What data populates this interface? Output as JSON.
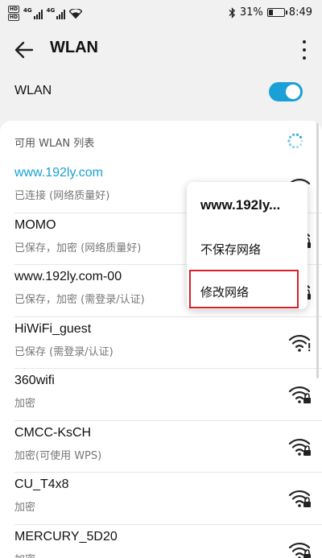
{
  "status_bar": {
    "hd_badges": [
      "HD",
      "HD"
    ],
    "network_tags": [
      "4G",
      "4G"
    ],
    "battery_percent": "31%",
    "battery_level": 0.31,
    "time": "8:49",
    "icons": [
      "bluetooth-icon",
      "wifi-icon",
      "signal-icon",
      "battery-icon"
    ]
  },
  "app_bar": {
    "title": "WLAN",
    "back_icon": "arrow-left-icon",
    "menu_icon": "more-vertical-icon"
  },
  "wlan_toggle": {
    "label": "WLAN",
    "on": true
  },
  "section": {
    "title": "可用 WLAN 列表"
  },
  "networks": [
    {
      "ssid": "www.192ly.com",
      "status": "已连接 (网络质量好)",
      "connected": true,
      "icon": "wifi-icon"
    },
    {
      "ssid": "MOMO",
      "status": "已保存，加密 (网络质量好)",
      "connected": false,
      "icon": "wifi-lock-icon"
    },
    {
      "ssid": "www.192ly.com-00",
      "status": "已保存，加密 (需登录/认证)",
      "connected": false,
      "icon": "wifi-lock-icon"
    },
    {
      "ssid": "HiWiFi_guest",
      "status": "已保存 (需登录/认证)",
      "connected": false,
      "icon": "wifi-alert-icon"
    },
    {
      "ssid": "360wifi",
      "status": "加密",
      "connected": false,
      "icon": "wifi-lock-icon"
    },
    {
      "ssid": "CMCC-KsCH",
      "status": "加密(可使用 WPS)",
      "connected": false,
      "icon": "wifi-lock-icon"
    },
    {
      "ssid": "CU_T4x8",
      "status": "加密",
      "connected": false,
      "icon": "wifi-lock-icon"
    },
    {
      "ssid": "MERCURY_5D20",
      "status": "加密",
      "connected": false,
      "icon": "wifi-lock-icon"
    }
  ],
  "context_menu": {
    "header": "www.192ly...",
    "items": [
      "不保存网络",
      "修改网络"
    ],
    "highlighted_item": "修改网络",
    "highlight_color": "#d4212a"
  },
  "colors": {
    "accent": "#1aa0d6",
    "background": "#f1f1f1"
  }
}
